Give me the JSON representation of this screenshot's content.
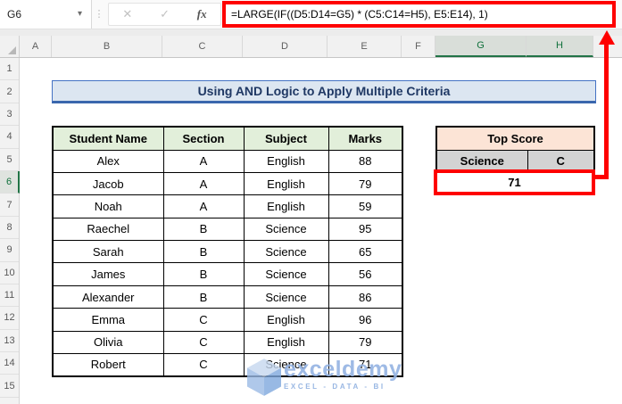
{
  "formula_bar": {
    "name_box_value": "G6",
    "dropdown_label": "▾",
    "dots_label": "⋮",
    "cancel_label": "✕",
    "enter_label": "✓",
    "fx_label": "fx",
    "formula": "=LARGE(IF((D5:D14=G5) * (C5:C14=H5), E5:E14), 1)"
  },
  "grid": {
    "column_headers": [
      "A",
      "B",
      "C",
      "D",
      "E",
      "F",
      "G",
      "H"
    ],
    "row_headers": [
      "1",
      "2",
      "3",
      "4",
      "5",
      "6",
      "7",
      "8",
      "9",
      "10",
      "11",
      "12",
      "13",
      "14",
      "15"
    ],
    "selected_cell": "G6",
    "selected_columns": "G,H",
    "selected_row": "6"
  },
  "title_banner": {
    "text": "Using AND Logic to Apply Multiple Criteria"
  },
  "students_table": {
    "headers": [
      "Student Name",
      "Section",
      "Subject",
      "Marks"
    ],
    "rows": [
      [
        "Alex",
        "A",
        "English",
        "88"
      ],
      [
        "Jacob",
        "A",
        "English",
        "79"
      ],
      [
        "Noah",
        "A",
        "English",
        "59"
      ],
      [
        "Raechel",
        "B",
        "Science",
        "95"
      ],
      [
        "Sarah",
        "B",
        "Science",
        "65"
      ],
      [
        "James",
        "B",
        "Science",
        "56"
      ],
      [
        "Alexander",
        "B",
        "Science",
        "86"
      ],
      [
        "Emma",
        "C",
        "English",
        "96"
      ],
      [
        "Olivia",
        "C",
        "English",
        "79"
      ],
      [
        "Robert",
        "C",
        "Science",
        "71"
      ]
    ]
  },
  "top_score_panel": {
    "title": "Top Score",
    "criteria_subject": "Science",
    "criteria_section": "C",
    "result": "71"
  },
  "watermark": {
    "brand": "exceldemy",
    "tagline": "EXCEL - DATA - BI"
  },
  "colors": {
    "annotation_red": "#fe0000",
    "title_bg": "#dce6f1",
    "title_text": "#1f3864",
    "title_border": "#4472c4",
    "table_header_bg": "#e2efda",
    "top_score_bg": "#fce4d6",
    "criteria_bg": "#d3d3d3",
    "excel_green": "#217346"
  }
}
